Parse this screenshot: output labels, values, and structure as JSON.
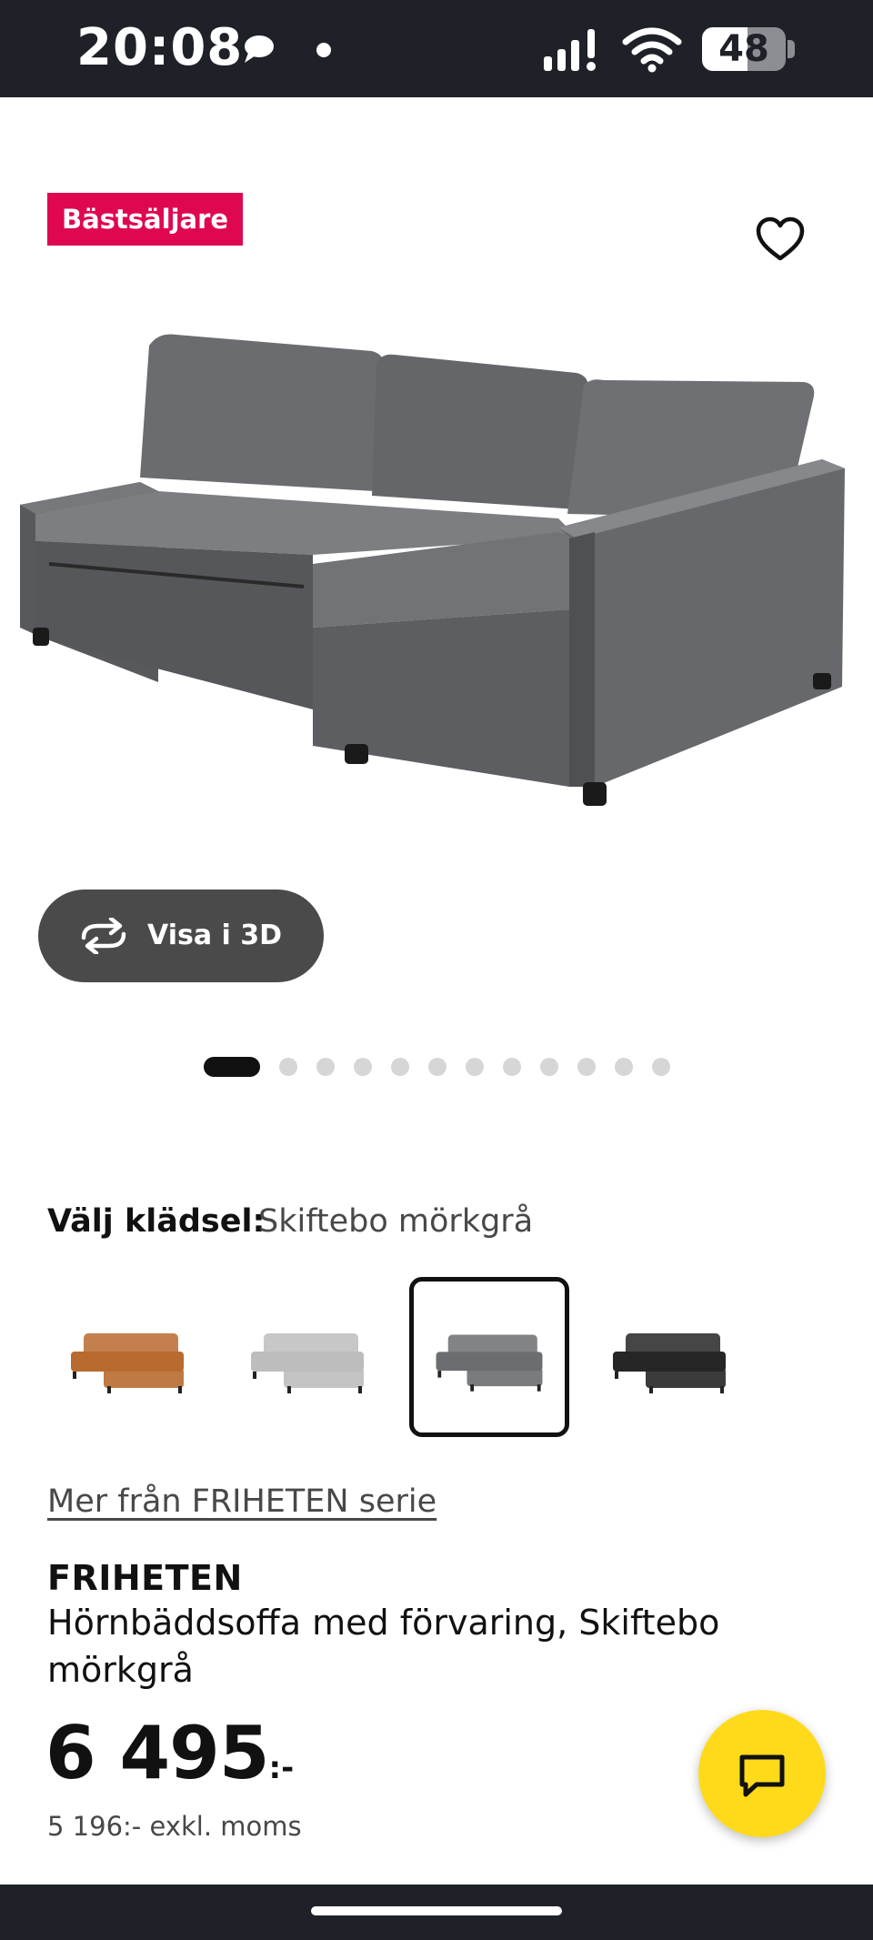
{
  "status_bar": {
    "time": "20:08",
    "battery": "48"
  },
  "product_image": {
    "badge": "Bästsäljare",
    "view_3d_label": "Visa i 3D",
    "carousel_total": 12,
    "carousel_active": 1
  },
  "upholstery": {
    "label": "Välj klädsel:",
    "selected": "Skiftebo mörkgrå",
    "options": [
      {
        "color": "#b86a2f",
        "selected": false
      },
      {
        "color": "#bdbdbd",
        "selected": false
      },
      {
        "color": "#6b6d70",
        "selected": true
      },
      {
        "color": "#262626",
        "selected": false
      }
    ]
  },
  "series_link": "Mer från FRIHETEN serie",
  "product": {
    "name": "FRIHETEN",
    "description": "Hörnbäddsoffa med förvaring, Skiftebo mörkgrå",
    "price": "6 495",
    "price_suffix": ":-",
    "price_ex_vat": "5 196:- exkl. moms"
  },
  "colors": {
    "badge": "#e00751",
    "chat_button": "#ffda1a",
    "status_bar": "#1f2128"
  },
  "icons": {
    "favorite": "heart-icon",
    "view_3d": "rotate-icon",
    "chat": "chat-icon"
  }
}
